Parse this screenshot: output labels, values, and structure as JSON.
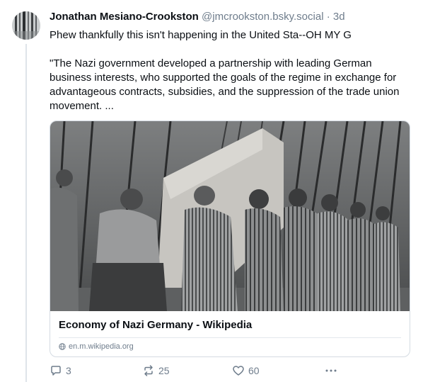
{
  "post": {
    "author": {
      "display_name": "Jonathan Mesiano-Crookston",
      "handle": "@jmcrookston.bsky.social",
      "separator": " · ",
      "time_ago": "3d"
    },
    "text_lines": [
      "Phew thankfully this isn't happening in the United Sta--OH MY G",
      "\"The Nazi government developed a partnership with leading German business interests, who supported the goals of the regime in exchange for advantageous contracts, subsidies, and the suppression of the trade union movement. ..."
    ],
    "link_card": {
      "title": "Economy of Nazi Germany - Wikipedia",
      "domain": "en.m.wikipedia.org"
    },
    "actions": {
      "reply_count": "3",
      "repost_count": "25",
      "like_count": "60"
    }
  },
  "colors": {
    "text": "#0b0f14",
    "muted": "#6f7d8c",
    "border": "#d4dbe2"
  },
  "icons": [
    "reply-icon",
    "repost-icon",
    "like-icon",
    "more-icon",
    "globe-icon"
  ]
}
